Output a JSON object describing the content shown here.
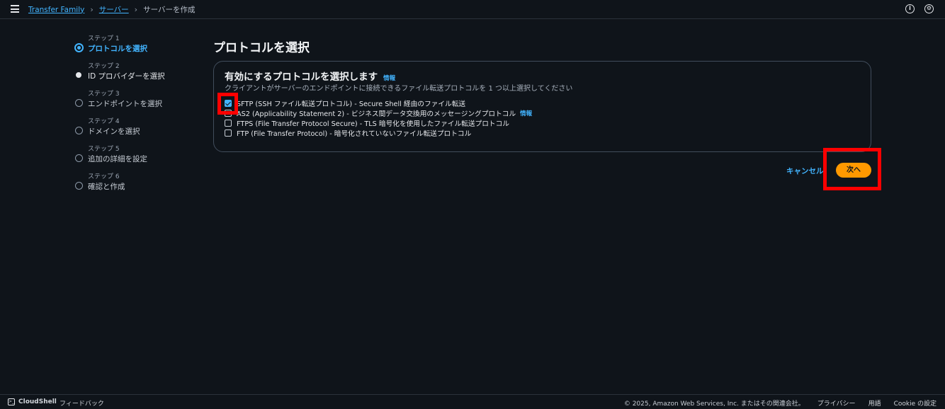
{
  "breadcrumb": {
    "items": [
      "Transfer Family",
      "サーバー"
    ],
    "current": "サーバーを作成"
  },
  "steps": [
    {
      "num": "ステップ 1",
      "label": "プロトコルを選択",
      "state": "active"
    },
    {
      "num": "ステップ 2",
      "label": "ID プロバイダーを選択",
      "state": "visited"
    },
    {
      "num": "ステップ 3",
      "label": "エンドポイントを選択",
      "state": "pending"
    },
    {
      "num": "ステップ 4",
      "label": "ドメインを選択",
      "state": "pending"
    },
    {
      "num": "ステップ 5",
      "label": "追加の詳細を設定",
      "state": "pending"
    },
    {
      "num": "ステップ 6",
      "label": "確認と作成",
      "state": "pending"
    }
  ],
  "page_title": "プロトコルを選択",
  "card": {
    "title": "有効にするプロトコルを選択します",
    "info": "情報",
    "description": "クライアントがサーバーのエンドポイントに接続できるファイル転送プロトコルを 1 つ以上選択してください",
    "options": [
      {
        "label": "SFTP (SSH ファイル転送プロトコル) - Secure Shell 経由のファイル転送",
        "checked": true
      },
      {
        "label": "AS2 (Applicability Statement 2) - ビジネス間データ交換用のメッセージングプロトコル",
        "checked": false,
        "info": "情報"
      },
      {
        "label": "FTPS (File Transfer Protocol Secure) - TLS 暗号化を使用したファイル転送プロトコル",
        "checked": false
      },
      {
        "label": "FTP (File Transfer Protocol) - 暗号化されていないファイル転送プロトコル",
        "checked": false
      }
    ]
  },
  "actions": {
    "cancel": "キャンセル",
    "next": "次へ"
  },
  "footer": {
    "cloudshell": "CloudShell",
    "feedback": "フィードバック",
    "copyright": "© 2025, Amazon Web Services, Inc. またはその関連会社。",
    "privacy": "プライバシー",
    "terms": "用語",
    "cookie": "Cookie の設定"
  },
  "colors": {
    "background": "#0f141a",
    "link": "#42b4ff",
    "primary_button": "#ff9900",
    "highlight": "#ff0000"
  }
}
